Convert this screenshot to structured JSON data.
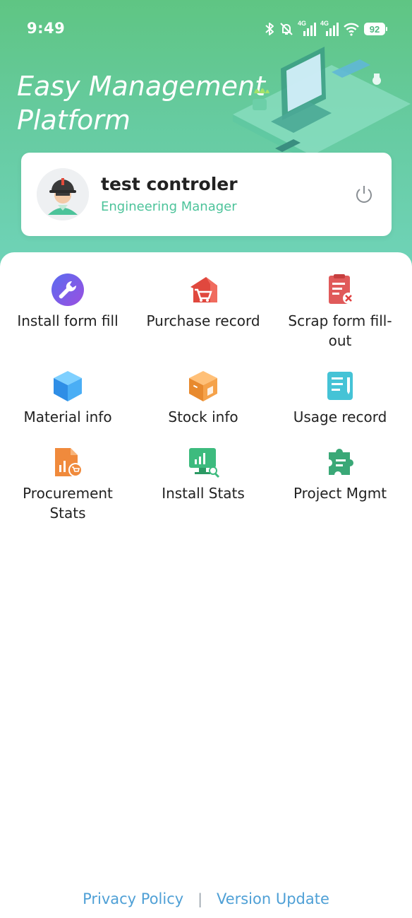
{
  "status_bar": {
    "time": "9:49",
    "network_1": "4G",
    "network_2": "4G",
    "battery": "92",
    "icons": [
      "bluetooth-icon",
      "mute-bell-icon",
      "signal-icon",
      "signal-icon",
      "wifi-icon",
      "battery-icon"
    ]
  },
  "header": {
    "title_line1": "Easy Management",
    "title_line2": "Platform",
    "colors": {
      "gradient_top": "#5fc583",
      "gradient_bottom": "#6fd3b8"
    }
  },
  "profile": {
    "name": "test controler",
    "role": "Engineering Manager",
    "role_color": "#4cc39a",
    "avatar_icon": "engineer-avatar-icon",
    "logout_icon": "power-icon"
  },
  "menu": {
    "items": [
      {
        "label": "Install form fill",
        "icon": "wrench-icon",
        "color": "#7b5cf0"
      },
      {
        "label": "Purchase record",
        "icon": "shop-cart-icon",
        "color": "#e0483e"
      },
      {
        "label": "Scrap form fill-out",
        "icon": "clipboard-x-icon",
        "color": "#e05a5a"
      },
      {
        "label": "Material info",
        "icon": "cube-icon",
        "color": "#3fa8ef"
      },
      {
        "label": "Stock info",
        "icon": "box-icon",
        "color": "#f0a04a"
      },
      {
        "label": "Usage record",
        "icon": "document-pen-icon",
        "color": "#45c3d6"
      },
      {
        "label": "Procurement Stats",
        "icon": "report-cart-icon",
        "color": "#f08a3c"
      },
      {
        "label": "Install Stats",
        "icon": "monitor-chart-icon",
        "color": "#3dbb7e"
      },
      {
        "label": "Project Mgmt",
        "icon": "puzzle-icon",
        "color": "#3aa877"
      }
    ]
  },
  "footer": {
    "privacy": "Privacy Policy",
    "separator": "|",
    "version": "Version Update",
    "link_color": "#4fa0d6"
  }
}
